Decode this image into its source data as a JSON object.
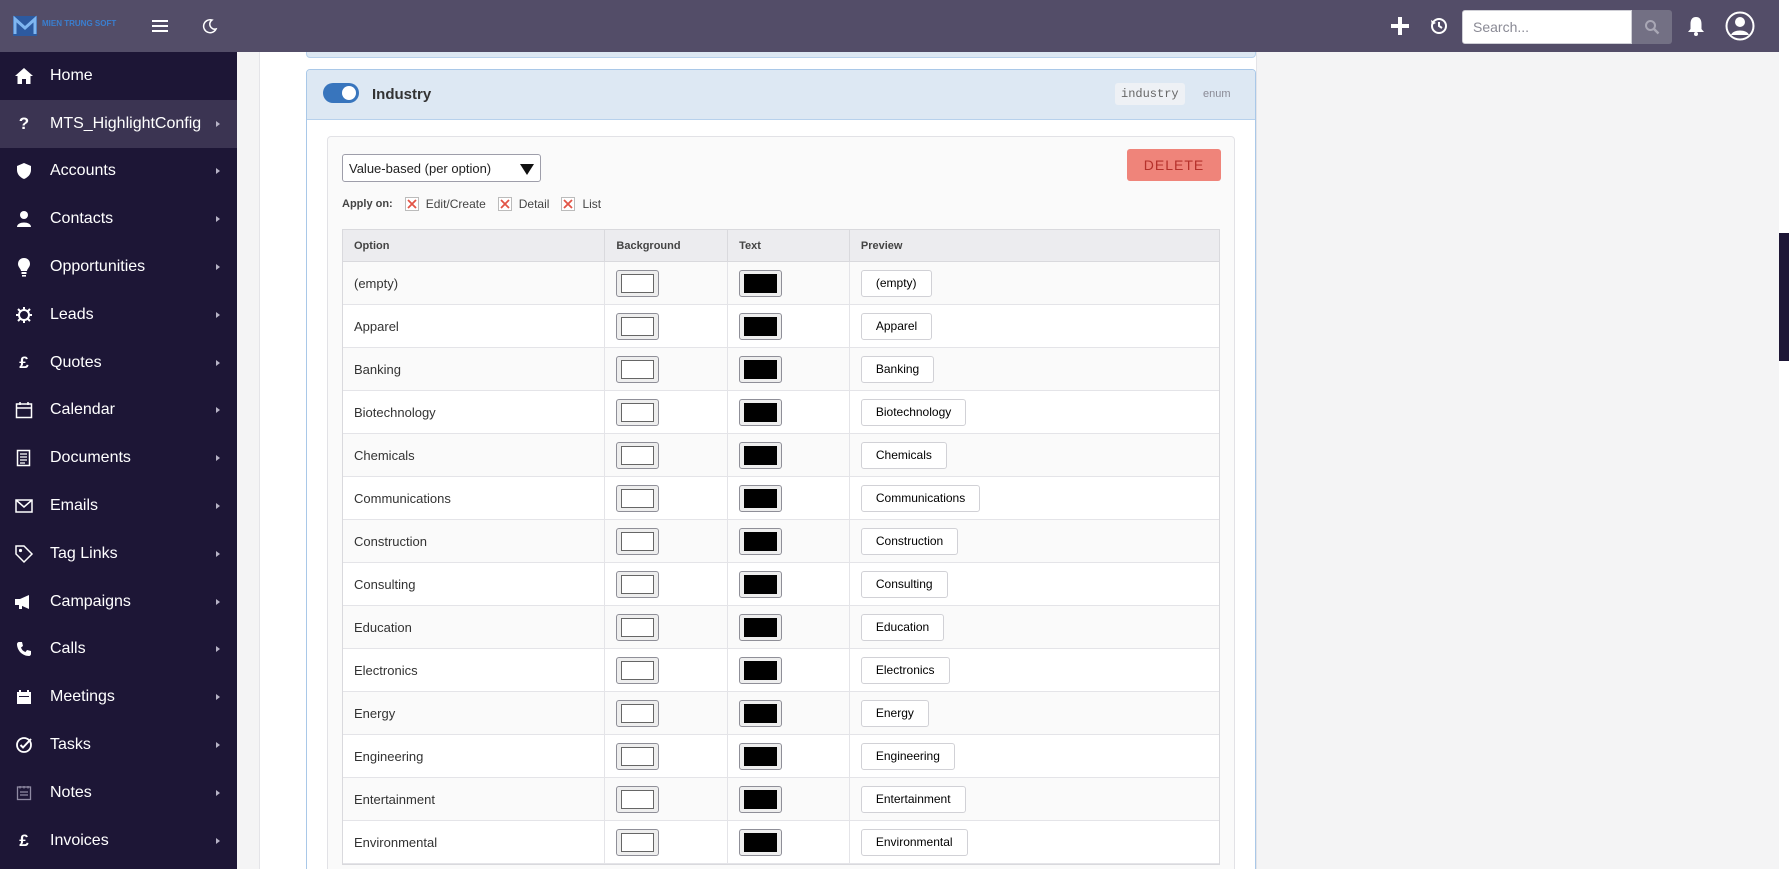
{
  "header": {
    "logo_text": "MIEN TRUNG SOFT",
    "search_placeholder": "Search...",
    "colors": {
      "bar": "#534d68",
      "sidebar": "#1d1636"
    }
  },
  "sidebar": {
    "items": [
      {
        "label": "Home",
        "icon": "home-icon",
        "glyph": ""
      },
      {
        "label": "MTS_HighlightConfig",
        "icon": "question-icon",
        "glyph": "?"
      },
      {
        "label": "Accounts",
        "icon": "shield-icon",
        "glyph": ""
      },
      {
        "label": "Contacts",
        "icon": "person-icon",
        "glyph": ""
      },
      {
        "label": "Opportunities",
        "icon": "lightbulb-icon",
        "glyph": ""
      },
      {
        "label": "Leads",
        "icon": "gear-icon",
        "glyph": ""
      },
      {
        "label": "Quotes",
        "icon": "pound-icon",
        "glyph": "£"
      },
      {
        "label": "Calendar",
        "icon": "calendar-icon",
        "glyph": ""
      },
      {
        "label": "Documents",
        "icon": "document-icon",
        "glyph": ""
      },
      {
        "label": "Emails",
        "icon": "envelope-icon",
        "glyph": ""
      },
      {
        "label": "Tag Links",
        "icon": "tag-icon",
        "glyph": ""
      },
      {
        "label": "Campaigns",
        "icon": "megaphone-icon",
        "glyph": ""
      },
      {
        "label": "Calls",
        "icon": "phone-icon",
        "glyph": ""
      },
      {
        "label": "Meetings",
        "icon": "meeting-calendar-icon",
        "glyph": ""
      },
      {
        "label": "Tasks",
        "icon": "target-icon",
        "glyph": ""
      },
      {
        "label": "Notes",
        "icon": "notes-icon",
        "glyph": ""
      },
      {
        "label": "Invoices",
        "icon": "pound-icon",
        "glyph": "£"
      }
    ]
  },
  "panel": {
    "title": "Industry",
    "field_name": "industry",
    "field_type": "enum",
    "mode_value": "Value-based (per option)",
    "delete_label": "DELETE",
    "apply_label": "Apply on:",
    "apply_options": [
      "Edit/Create",
      "Detail",
      "List"
    ],
    "columns": [
      "Option",
      "Background",
      "Text",
      "Preview"
    ],
    "rows": [
      {
        "option": "(empty)",
        "preview": "(empty)"
      },
      {
        "option": "Apparel",
        "preview": "Apparel"
      },
      {
        "option": "Banking",
        "preview": "Banking"
      },
      {
        "option": "Biotechnology",
        "preview": "Biotechnology"
      },
      {
        "option": "Chemicals",
        "preview": "Chemicals"
      },
      {
        "option": "Communications",
        "preview": "Communications"
      },
      {
        "option": "Construction",
        "preview": "Construction"
      },
      {
        "option": "Consulting",
        "preview": "Consulting"
      },
      {
        "option": "Education",
        "preview": "Education"
      },
      {
        "option": "Electronics",
        "preview": "Electronics"
      },
      {
        "option": "Energy",
        "preview": "Energy"
      },
      {
        "option": "Engineering",
        "preview": "Engineering"
      },
      {
        "option": "Entertainment",
        "preview": "Entertainment"
      },
      {
        "option": "Environmental",
        "preview": "Environmental"
      }
    ],
    "background_color": "#ffffff",
    "text_color": "#000000"
  }
}
